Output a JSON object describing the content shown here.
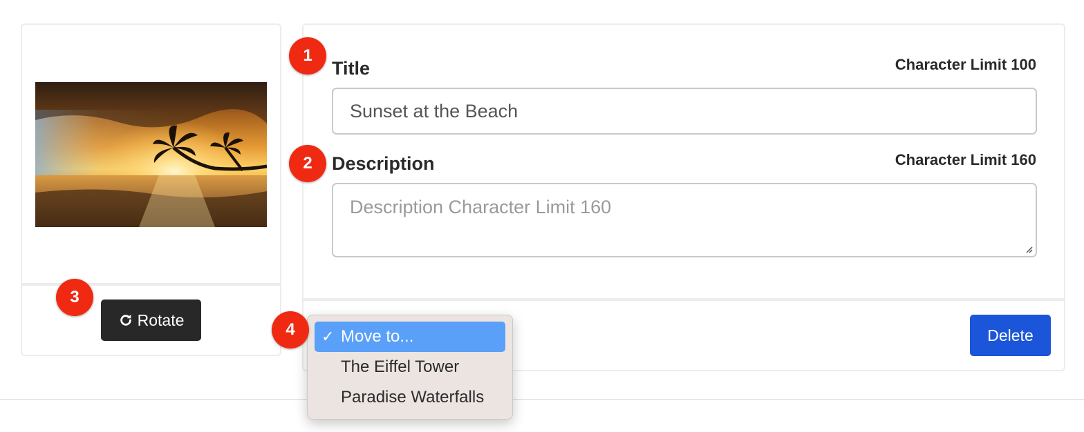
{
  "image_card": {
    "image_alt": "Sunset at the Beach",
    "rotate_label": "Rotate",
    "rotate_icon": "rotate-clockwise-icon"
  },
  "form": {
    "title_label": "Title",
    "title_limit": "Character Limit 100",
    "title_value": "Sunset at the Beach",
    "description_label": "Description",
    "description_limit": "Character Limit 160",
    "description_placeholder": "Description Character Limit 160",
    "description_value": "",
    "delete_label": "Delete"
  },
  "move_dropdown": {
    "selected": "Move to...",
    "options": [
      "Move to...",
      "The Eiffel Tower",
      "Paradise Waterfalls"
    ]
  },
  "badges": [
    "1",
    "2",
    "3",
    "4"
  ],
  "colors": {
    "badge": "#f02a12",
    "delete_button": "#1b55d9",
    "rotate_button": "#282828",
    "dropdown_highlight": "#5aa0f9"
  }
}
